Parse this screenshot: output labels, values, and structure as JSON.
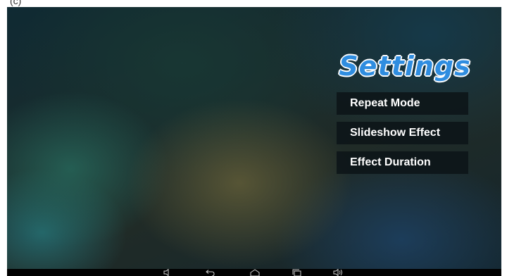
{
  "top_caption": "(c)",
  "title": "Settings",
  "menu": {
    "items": [
      {
        "label": "Repeat Mode"
      },
      {
        "label": "Slideshow Effect"
      },
      {
        "label": "Effect Duration"
      }
    ]
  },
  "navbar": {
    "icons": [
      "volume-down-icon",
      "back-icon",
      "home-icon",
      "recent-apps-icon",
      "volume-up-icon"
    ]
  },
  "colors": {
    "title": "#2f8de0",
    "menu_item_bg": "#0c1418",
    "navbar_bg": "#000000"
  }
}
